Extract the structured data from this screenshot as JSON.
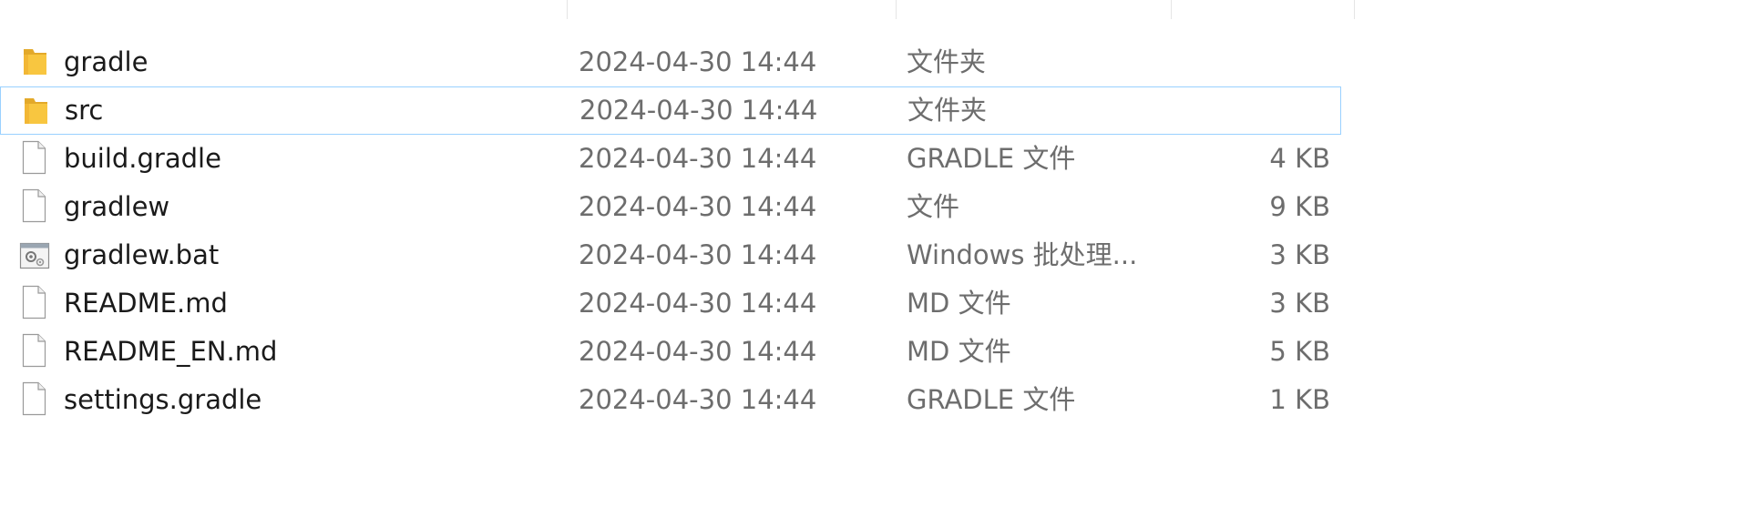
{
  "columns": {
    "name": "",
    "date": "",
    "type": "",
    "size": ""
  },
  "files": [
    {
      "name": "gradle",
      "date": "2024-04-30 14:44",
      "type": "文件夹",
      "size": "",
      "icon": "folder-icon",
      "selected": false
    },
    {
      "name": "src",
      "date": "2024-04-30 14:44",
      "type": "文件夹",
      "size": "",
      "icon": "folder-icon",
      "selected": true
    },
    {
      "name": "build.gradle",
      "date": "2024-04-30 14:44",
      "type": "GRADLE 文件",
      "size": "4 KB",
      "icon": "file-icon",
      "selected": false
    },
    {
      "name": "gradlew",
      "date": "2024-04-30 14:44",
      "type": "文件",
      "size": "9 KB",
      "icon": "file-icon",
      "selected": false
    },
    {
      "name": "gradlew.bat",
      "date": "2024-04-30 14:44",
      "type": "Windows 批处理...",
      "size": "3 KB",
      "icon": "batch-file-icon",
      "selected": false
    },
    {
      "name": "README.md",
      "date": "2024-04-30 14:44",
      "type": "MD 文件",
      "size": "3 KB",
      "icon": "file-icon",
      "selected": false
    },
    {
      "name": "README_EN.md",
      "date": "2024-04-30 14:44",
      "type": "MD 文件",
      "size": "5 KB",
      "icon": "file-icon",
      "selected": false
    },
    {
      "name": "settings.gradle",
      "date": "2024-04-30 14:44",
      "type": "GRADLE 文件",
      "size": "1 KB",
      "icon": "file-icon",
      "selected": false
    }
  ],
  "colors": {
    "selection_border": "#99d1ff",
    "folder": "#f8c640",
    "text_primary": "#1a1a1a",
    "text_secondary": "#6d6d6d"
  }
}
